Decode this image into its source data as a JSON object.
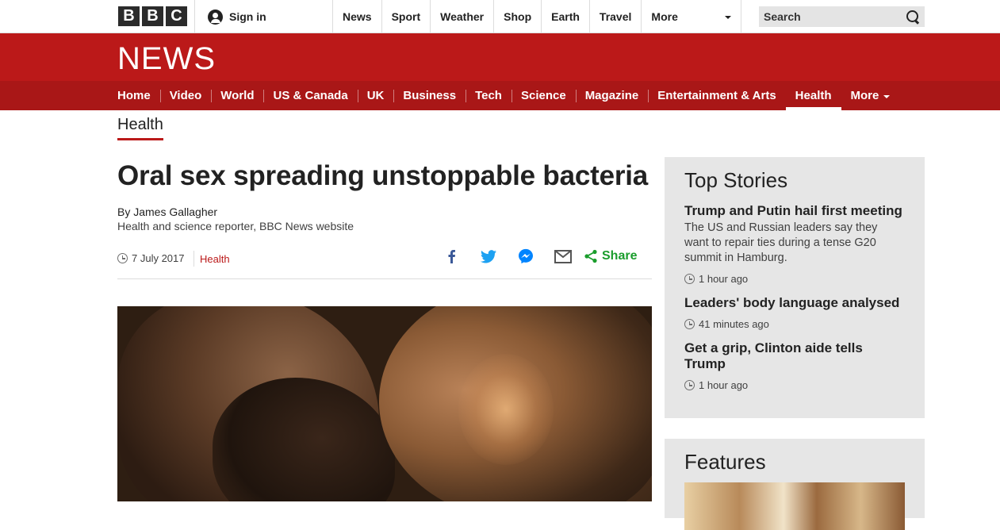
{
  "topbar": {
    "logo_letters": [
      "B",
      "B",
      "C"
    ],
    "signin_label": "Sign in",
    "nav": [
      "News",
      "Sport",
      "Weather",
      "Shop",
      "Earth",
      "Travel"
    ],
    "more_label": "More",
    "search_placeholder": "Search"
  },
  "banner": {
    "title": "NEWS"
  },
  "news_nav": {
    "items": [
      "Home",
      "Video",
      "World",
      "US & Canada",
      "UK",
      "Business",
      "Tech",
      "Science",
      "Magazine",
      "Entertainment & Arts",
      "Health"
    ],
    "active": "Health",
    "more_label": "More"
  },
  "section_label": "Health",
  "article": {
    "headline": "Oral sex spreading unstoppable bacteria",
    "byline": "By James Gallagher",
    "role": "Health and science reporter, BBC News website",
    "date": "7 July 2017",
    "category": "Health",
    "share_label": "Share"
  },
  "top_stories": {
    "heading": "Top Stories",
    "items": [
      {
        "title": "Trump and Putin hail first meeting",
        "summary": "The US and Russian leaders say they want to repair ties during a tense G20 summit in Hamburg.",
        "time": "1 hour ago"
      },
      {
        "title": "Leaders' body language analysed",
        "summary": "",
        "time": "41 minutes ago"
      },
      {
        "title": "Get a grip, Clinton aide tells Trump",
        "summary": "",
        "time": "1 hour ago"
      }
    ]
  },
  "features": {
    "heading": "Features"
  },
  "colors": {
    "brand_red": "#bb1919",
    "nav_red": "#a91717",
    "share_green": "#1a9d2c"
  }
}
